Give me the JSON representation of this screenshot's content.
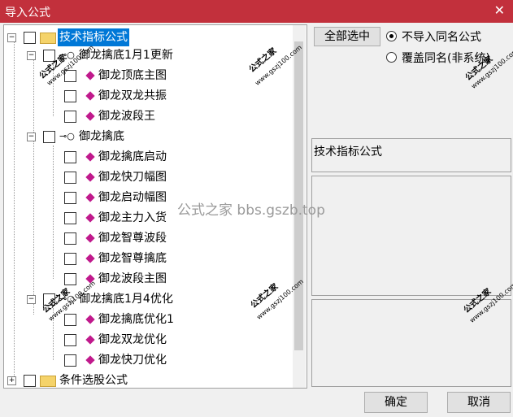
{
  "window": {
    "title": "导入公式",
    "close_symbol": "✕"
  },
  "tree": {
    "root": "技术指标公式",
    "groups": [
      {
        "label": "御龙擒底1月1更新",
        "items": [
          "御龙顶底主图",
          "御龙双龙共振",
          "御龙波段王"
        ]
      },
      {
        "label": "御龙擒底",
        "items": [
          "御龙擒底启动",
          "御龙快刀幅图",
          "御龙启动幅图",
          "御龙主力入货",
          "御龙智尊波段",
          "御龙智尊擒底",
          "御龙波段主图"
        ]
      },
      {
        "label": "御龙擒底1月4优化",
        "items": [
          "御龙擒底优化1",
          "御龙双龙优化",
          "御龙快刀优化"
        ]
      }
    ],
    "bottom": "条件选股公式"
  },
  "right": {
    "select_all": "全部选中",
    "radio_no_import": "不导入同名公式",
    "radio_overwrite": "覆盖同名(非系统)",
    "type_text": "技术指标公式"
  },
  "watermark_center": "公式之家 bbs.gszb.top",
  "stamp": {
    "title": "公式之家",
    "url": "www.gszj100.com"
  },
  "buttons": {
    "ok": "确定",
    "cancel": "取消"
  }
}
